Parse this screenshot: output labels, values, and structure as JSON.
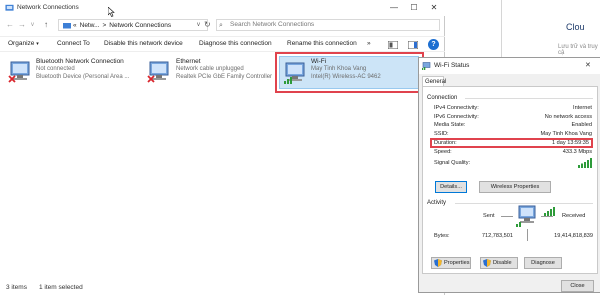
{
  "explorer": {
    "title": "Network Connections",
    "controls": [
      "—",
      "☐",
      "✕"
    ],
    "address": {
      "path_icon": "«",
      "segment1": "Netw...",
      "separator": ">",
      "segment2": "Network Connections",
      "dropdown": "v"
    },
    "search_placeholder": "Search Network Connections",
    "toolbar": {
      "organize": "Organize",
      "connect_to": "Connect To",
      "disable": "Disable this network device",
      "diagnose": "Diagnose this connection",
      "rename": "Rename this connection",
      "more": "»",
      "help": "?"
    },
    "adapters": [
      {
        "name": "Bluetooth Network Connection",
        "status": "Not connected",
        "device": "Bluetooth Device (Personal Area ...",
        "error": true
      },
      {
        "name": "Ethernet",
        "status": "Network cable unplugged",
        "device": "Realtek PCIe GbE Family Controller",
        "error": true
      },
      {
        "name": "Wi-Fi",
        "status": "May Tinh Khoa Vang",
        "device": "Intel(R) Wireless-AC 9462",
        "error": false
      }
    ],
    "status_bar": {
      "items_count": "3 items",
      "selected": "1 item selected"
    }
  },
  "dialog": {
    "title": "Wi-Fi Status",
    "close": "✕",
    "tab": "General",
    "connection_group": "Connection",
    "fields": [
      {
        "key": "IPv4 Connectivity:",
        "value": "Internet"
      },
      {
        "key": "IPv6 Connectivity:",
        "value": "No network access"
      },
      {
        "key": "Media State:",
        "value": "Enabled"
      },
      {
        "key": "SSID:",
        "value": "May Tinh Khoa Vang"
      },
      {
        "key": "Duration:",
        "value": "1 day 13:59:35"
      },
      {
        "key": "Speed:",
        "value": "433.3 Mbps"
      }
    ],
    "signal_quality_label": "Signal Quality:",
    "details_button": "Details...",
    "wireless_props_button": "Wireless Properties",
    "activity_group": "Activity",
    "sent_label": "Sent",
    "received_label": "Received",
    "bytes_label": "Bytes:",
    "bytes_sent": "712,783,501",
    "bytes_received": "19,414,818,839",
    "properties_button": "Properties",
    "disable_button": "Disable",
    "diagnose_button": "Diagnose",
    "close_button": "Close"
  },
  "right_app": {
    "title": "Clou",
    "subtitle": "Lưu trữ và truy cậ"
  }
}
